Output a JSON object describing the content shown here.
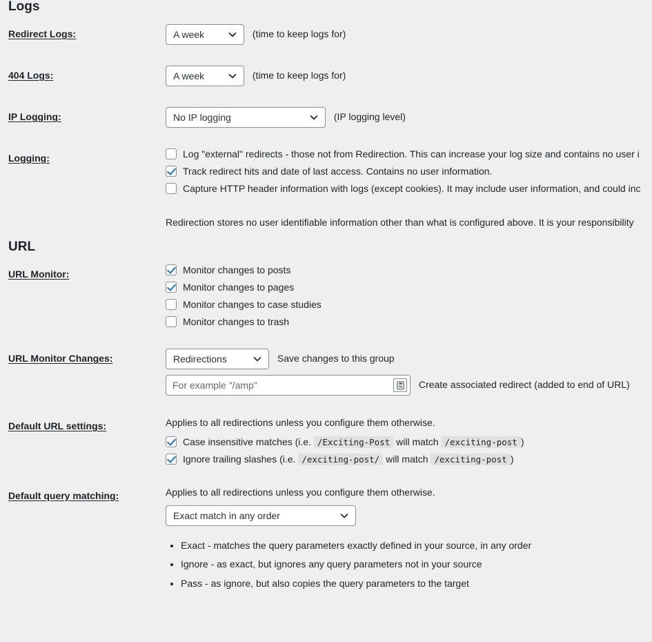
{
  "sections": {
    "logs": {
      "heading": "Logs",
      "redirect_logs": {
        "label": "Redirect Logs:",
        "select_value": "A week",
        "note": "(time to keep logs for)"
      },
      "logs_404": {
        "label": "404 Logs:",
        "select_value": "A week",
        "note": "(time to keep logs for)"
      },
      "ip_logging": {
        "label": "IP Logging:",
        "select_value": "No IP logging",
        "note": "(IP logging level)"
      },
      "logging": {
        "label": "Logging:",
        "options": [
          {
            "checked": false,
            "text": "Log \"external\" redirects - those not from Redirection. This can increase your log size and contains no user i"
          },
          {
            "checked": true,
            "text": "Track redirect hits and date of last access. Contains no user information."
          },
          {
            "checked": false,
            "text": "Capture HTTP header information with logs (except cookies). It may include user information, and could inc"
          }
        ],
        "description": "Redirection stores no user identifiable information other than what is configured above. It is your responsibility"
      }
    },
    "url": {
      "heading": "URL",
      "url_monitor": {
        "label": "URL Monitor:",
        "options": [
          {
            "checked": true,
            "text": "Monitor changes to posts"
          },
          {
            "checked": true,
            "text": "Monitor changes to pages"
          },
          {
            "checked": false,
            "text": "Monitor changes to case studies"
          },
          {
            "checked": false,
            "text": "Monitor changes to trash"
          }
        ]
      },
      "url_monitor_changes": {
        "label": "URL Monitor Changes:",
        "group_select_value": "Redirections",
        "group_note": "Save changes to this group",
        "input_placeholder": "For example \"/amp\"",
        "input_value": "",
        "input_note": "Create associated redirect (added to end of URL)",
        "input_button_icon": "insert-icon"
      },
      "default_url_settings": {
        "label": "Default URL settings:",
        "intro": "Applies to all redirections unless you configure them otherwise.",
        "options": [
          {
            "checked": true,
            "prefix": "Case insensitive matches (i.e.",
            "code1": "/Exciting-Post",
            "middle": "will match",
            "code2": "/exciting-post",
            "suffix": ")"
          },
          {
            "checked": true,
            "prefix": "Ignore trailing slashes (i.e.",
            "code1": "/exciting-post/",
            "middle": "will match",
            "code2": "/exciting-post",
            "suffix": ")"
          }
        ]
      },
      "default_query_matching": {
        "label": "Default query matching:",
        "intro": "Applies to all redirections unless you configure them otherwise.",
        "select_value": "Exact match in any order",
        "bullets": [
          "Exact - matches the query parameters exactly defined in your source, in any order",
          "Ignore - as exact, but ignores any query parameters not in your source",
          "Pass - as ignore, but also copies the query parameters to the target"
        ]
      }
    }
  },
  "colors": {
    "page_background": "#efefef",
    "text": "#1d2327",
    "control_border": "#8c8f94",
    "checkbox_check": "#2271b1",
    "code_background": "#e0e0e0"
  }
}
